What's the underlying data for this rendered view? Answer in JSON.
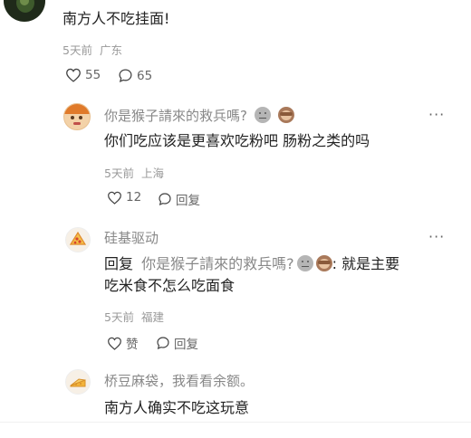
{
  "top_comment": {
    "text": "南方人不吃挂面!",
    "time": "5天前",
    "location": "广东",
    "likes": "55",
    "comments": "65"
  },
  "replies": [
    {
      "username": "你是猴子請來的救兵嗎?",
      "text": "你们吃应该是更喜欢吃粉吧 肠粉之类的吗",
      "time": "5天前",
      "location": "上海",
      "likes": "12",
      "reply_label": "回复"
    },
    {
      "username": "硅基驱动",
      "reply_prefix": "回复",
      "mention": "你是猴子請來的救兵嗎?",
      "text_after": ": 就是主要",
      "text_line2": "吃米食不怎么吃面食",
      "time": "5天前",
      "location": "福建",
      "likes": "赞",
      "reply_label": "回复"
    },
    {
      "username": "桥豆麻袋，我看看余额。",
      "text": "南方人确实不吃这玩意"
    }
  ],
  "more_label": "···"
}
